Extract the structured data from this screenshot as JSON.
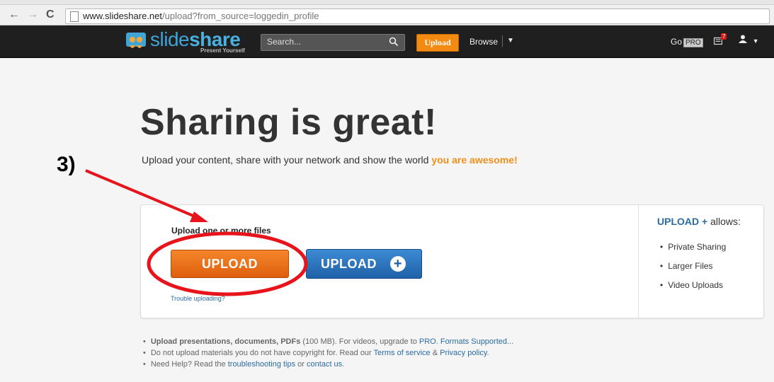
{
  "browser": {
    "url_host": "www.slideshare.net",
    "url_path": "/upload?from_source=loggedin_profile",
    "back_icon": "back-arrow-icon",
    "forward_icon": "forward-arrow-icon",
    "reload_icon": "reload-icon"
  },
  "header": {
    "logo_text_a": "slide",
    "logo_text_b": "share",
    "tagline": "Present Yourself",
    "search_placeholder": "Search...",
    "upload_label": "Upload",
    "browse_label": "Browse",
    "gopro_label": "Go",
    "pro_badge": "PRO",
    "notification_count": "7"
  },
  "main": {
    "title": "Sharing is great!",
    "subtitle": "Upload your content, share with your network and show the world",
    "subtitle_accent": "you are awesome!",
    "annotation": "3)",
    "files_label": "Upload one or more files",
    "upload_button": "UPLOAD",
    "upload_plus_button": "UPLOAD",
    "plus_symbol": "+",
    "trouble_link": "Trouble uploading?",
    "allows_title_highlight": "UPLOAD +",
    "allows_title_rest": " allows:",
    "allows_items": [
      "Private Sharing",
      "Larger Files",
      "Video Uploads"
    ]
  },
  "notes": {
    "n1_bold": "Upload presentations, documents, PDFs",
    "n1_text": " (100 MB). For videos, upgrade to ",
    "n1_link1": "PRO",
    "n1_sep": ". ",
    "n1_link2": "Formats Supported...",
    "n2_text": "Do not upload materials you do not have copyright for. Read our ",
    "n2_link1": "Terms of service",
    "n2_amp": " & ",
    "n2_link2": "Privacy policy",
    "n2_end": ".",
    "n3_text": "Need Help? Read the ",
    "n3_link1": "troubleshooting tips",
    "n3_or": " or ",
    "n3_link2": "contact us",
    "n3_end": "."
  },
  "colors": {
    "accent_orange": "#f38a12",
    "link_blue": "#2a6ca3",
    "annotation_red": "#e8141b"
  }
}
